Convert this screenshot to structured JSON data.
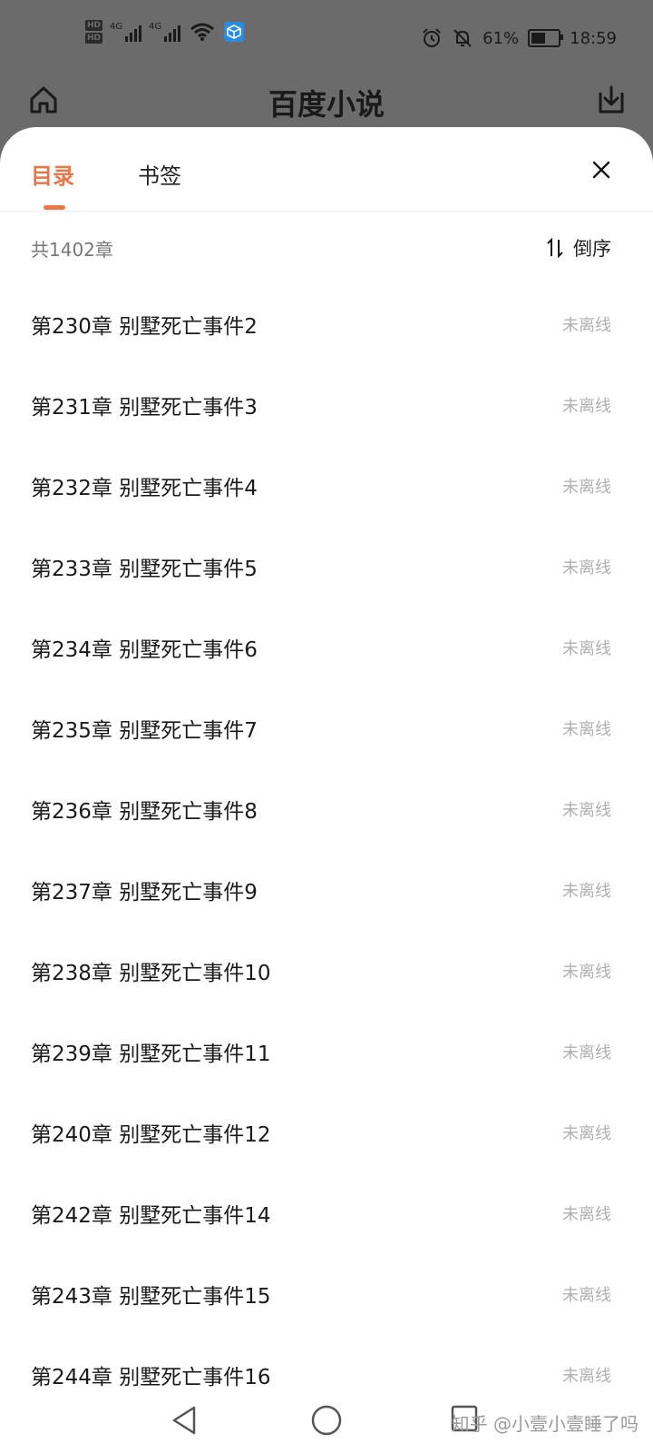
{
  "status_bar": {
    "hd1": "HD",
    "hd2": "HD",
    "net1": "4G",
    "net2": "4G",
    "battery_text": "61%",
    "battery_level": 0.61,
    "time": "18:59"
  },
  "app_bar": {
    "title": "百度小说",
    "home_icon": "home-icon",
    "download_icon": "download-icon"
  },
  "sheet": {
    "tabs": [
      {
        "label": "目录",
        "active": true
      },
      {
        "label": "书签",
        "active": false
      }
    ],
    "close_icon": "close-icon",
    "count_text": "共1402章",
    "sort_label": "倒序",
    "accent_color": "#e8774a",
    "chapters": [
      {
        "title": "第230章 别墅死亡事件2",
        "status": "未离线"
      },
      {
        "title": "第231章 别墅死亡事件3",
        "status": "未离线"
      },
      {
        "title": "第232章 别墅死亡事件4",
        "status": "未离线"
      },
      {
        "title": "第233章 别墅死亡事件5",
        "status": "未离线"
      },
      {
        "title": "第234章 别墅死亡事件6",
        "status": "未离线"
      },
      {
        "title": "第235章 别墅死亡事件7",
        "status": "未离线"
      },
      {
        "title": "第236章 别墅死亡事件8",
        "status": "未离线"
      },
      {
        "title": "第237章 别墅死亡事件9",
        "status": "未离线"
      },
      {
        "title": "第238章 别墅死亡事件10",
        "status": "未离线"
      },
      {
        "title": "第239章 别墅死亡事件11",
        "status": "未离线"
      },
      {
        "title": "第240章 别墅死亡事件12",
        "status": "未离线"
      },
      {
        "title": "第242章 别墅死亡事件14",
        "status": "未离线"
      },
      {
        "title": "第243章 别墅死亡事件15",
        "status": "未离线"
      },
      {
        "title": "第244章 别墅死亡事件16",
        "status": "未离线"
      }
    ]
  },
  "nav_bar": {
    "watermark": "知乎 @小壹小壹睡了吗"
  }
}
